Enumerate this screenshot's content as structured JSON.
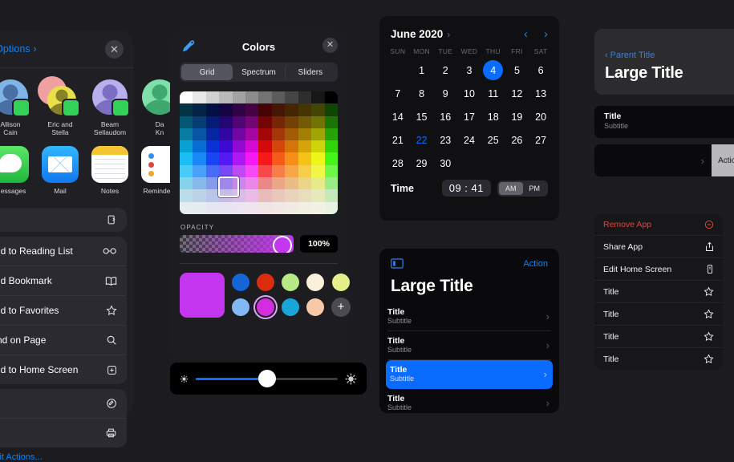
{
  "share_sheet": {
    "options_label": "Options",
    "close_icon": "close-icon",
    "people": [
      {
        "name": "Allison\nCain",
        "color1": "#7fb4e8",
        "color2": "#4a6fa5",
        "badge": "#33d158"
      },
      {
        "name": "Eric and\nStella",
        "color1": "#f0a0a0",
        "color2": "#e8e04a",
        "badge": "#33d158"
      },
      {
        "name": "Beam\nSellaudom",
        "color1": "#b9aeee",
        "color2": "#7a6fc0",
        "badge": "#33d158"
      },
      {
        "name": "Da\nKn",
        "color1": "#7ee0a8",
        "color2": "#3fa86e",
        "badge": "#33d158"
      }
    ],
    "apps": [
      {
        "name": "Messages",
        "icon": "messages-icon"
      },
      {
        "name": "Mail",
        "icon": "mail-icon"
      },
      {
        "name": "Notes",
        "icon": "notes-icon"
      },
      {
        "name": "Reminders",
        "icon": "reminders-icon"
      }
    ],
    "copy_row": {
      "label": "",
      "icon": "copy-icon"
    },
    "actions": [
      {
        "label": "Add to Reading List",
        "icon": "glasses-icon"
      },
      {
        "label": "Add Bookmark",
        "icon": "book-icon"
      },
      {
        "label": "Add to Favorites",
        "icon": "star-icon"
      },
      {
        "label": "Find on Page",
        "icon": "search-icon"
      },
      {
        "label": "Add to Home Screen",
        "icon": "add-box-icon"
      }
    ],
    "extra_rows": [
      {
        "label": "",
        "icon": "markup-icon"
      },
      {
        "label": "",
        "icon": "print-icon"
      }
    ],
    "edit_label": "Edit Actions..."
  },
  "colors": {
    "title": "Colors",
    "eyedropper_icon": "eyedropper-icon",
    "close_icon": "close-icon",
    "tabs": [
      {
        "label": "Grid",
        "selected": true
      },
      {
        "label": "Spectrum",
        "selected": false
      },
      {
        "label": "Sliders",
        "selected": false
      }
    ],
    "opacity_label": "OPACITY",
    "opacity_value": "100%",
    "selected_color": "#c536f0",
    "grid_cursor": {
      "col": 3,
      "row": 7
    },
    "swatches_row1": [
      "#1565d8",
      "#d92d0e",
      "#b8e986",
      "#faf0dc",
      "#e6f08a"
    ],
    "swatches_row2": [
      "#82b9f5",
      "#d42de0",
      "#18a6d9",
      "#f8c9a8"
    ],
    "add_label": "+",
    "selected_swatch_index": 1
  },
  "brightness": {
    "min_icon": "sun-small-icon",
    "max_icon": "sun-large-icon",
    "value": 50,
    "fill_color": "#0a6cff"
  },
  "calendar": {
    "month": "June 2020",
    "month_chevron": "chevron-right-icon",
    "prev_icon": "chevron-left-icon",
    "next_icon": "chevron-right-icon",
    "dows": [
      "SUN",
      "MON",
      "TUE",
      "WED",
      "THU",
      "FRI",
      "SAT"
    ],
    "leading_blanks": 1,
    "days": [
      1,
      2,
      3,
      4,
      5,
      6,
      7,
      8,
      9,
      10,
      11,
      12,
      13,
      14,
      15,
      16,
      17,
      18,
      19,
      20,
      21,
      22,
      23,
      24,
      25,
      26,
      27,
      28,
      29,
      30
    ],
    "selected_day": 4,
    "today_day": 22,
    "time_label": "Time",
    "time_value": "09 : 41",
    "ampm": [
      {
        "label": "AM",
        "selected": true
      },
      {
        "label": "PM",
        "selected": false
      }
    ],
    "accent": "#0a6cff"
  },
  "center_list": {
    "sidebar_icon": "sidebar-toggle-icon",
    "action_label": "Action",
    "title": "Large Title",
    "rows": [
      {
        "title": "Title",
        "subtitle": "Subtitle",
        "selected": false
      },
      {
        "title": "Title",
        "subtitle": "Subtitle",
        "selected": false
      },
      {
        "title": "Title",
        "subtitle": "Subtitle",
        "selected": true
      },
      {
        "title": "Title",
        "subtitle": "Subtitle",
        "selected": false
      }
    ]
  },
  "right": {
    "nav": {
      "back_icon": "chevron-left-icon",
      "back_label": "Parent Title",
      "title": "Large Title"
    },
    "list_row": {
      "title": "Title",
      "subtitle": "Subtitle"
    },
    "swipe": {
      "chevron": "chevron-right-icon",
      "action_label": "Action"
    },
    "context_menu": [
      {
        "label": "Remove App",
        "icon": "minus-circle-icon",
        "danger": true
      },
      {
        "label": "Share App",
        "icon": "share-icon",
        "danger": false
      },
      {
        "label": "Edit Home Screen",
        "icon": "edit-icon",
        "danger": false
      },
      {
        "label": "Title",
        "icon": "star-icon",
        "danger": false
      },
      {
        "label": "Title",
        "icon": "star-icon",
        "danger": false
      },
      {
        "label": "Title",
        "icon": "star-icon",
        "danger": false
      },
      {
        "label": "Title",
        "icon": "star-icon",
        "danger": false
      }
    ]
  }
}
